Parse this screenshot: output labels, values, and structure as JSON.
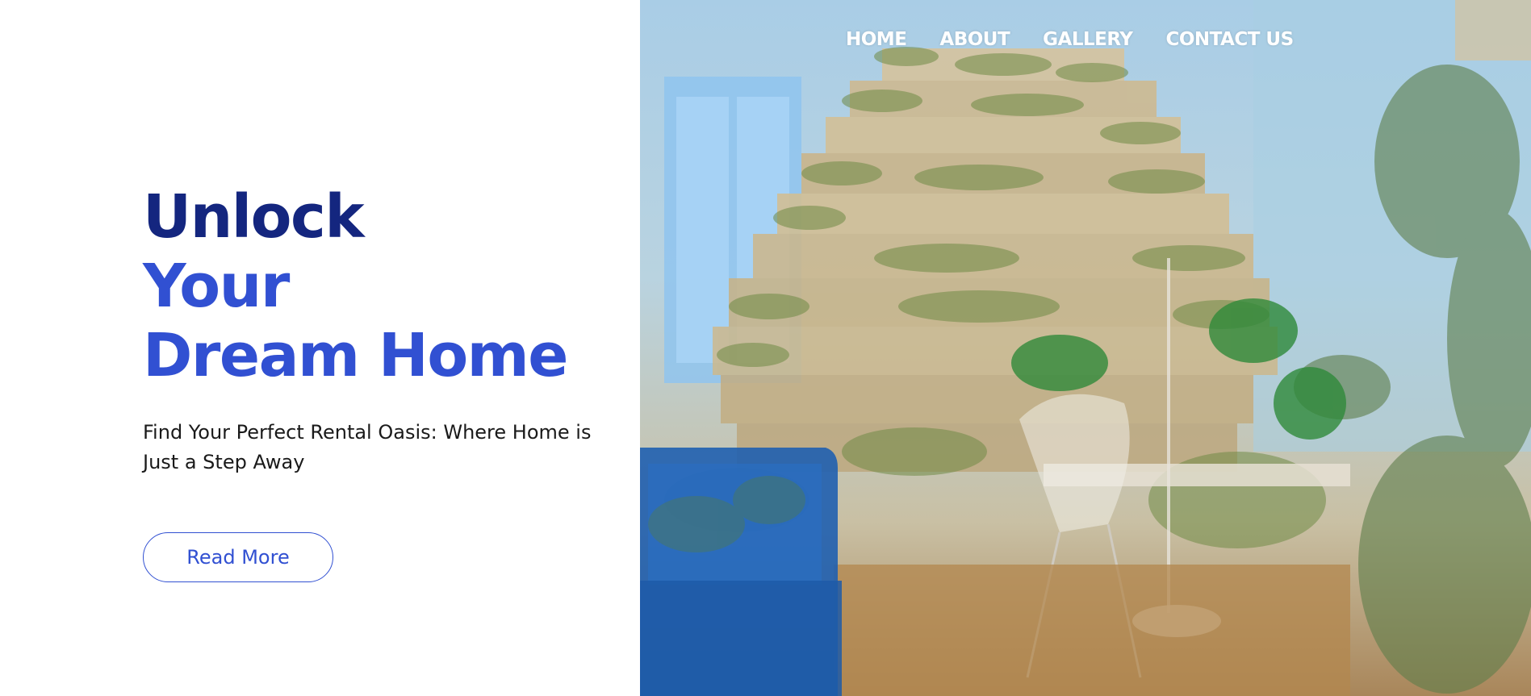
{
  "nav": {
    "items": [
      {
        "label": "HOME"
      },
      {
        "label": "ABOUT"
      },
      {
        "label": "GALLERY"
      },
      {
        "label": "CONTACT US"
      }
    ]
  },
  "hero": {
    "headline_line1": "Unlock",
    "headline_line2": "Your",
    "headline_line3": "Dream Home",
    "tagline": "Find Your Perfect Rental Oasis: Where Home is Just a Step Away",
    "cta_label": "Read More"
  },
  "colors": {
    "headline_dark": "#14267f",
    "accent_blue": "#3150d2",
    "nav_text": "#ffffff"
  }
}
